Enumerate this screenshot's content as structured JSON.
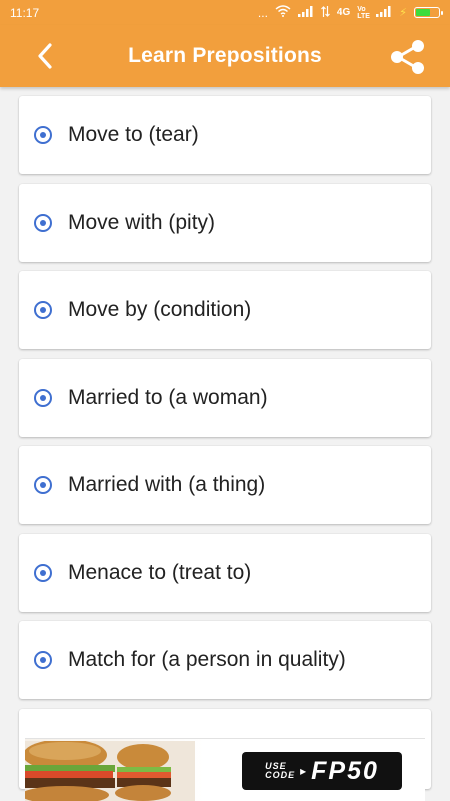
{
  "status_bar": {
    "time": "11:17",
    "dots": "...",
    "network": "4G",
    "volte": "Vo LTE"
  },
  "app_bar": {
    "title": "Learn Prepositions"
  },
  "items": [
    {
      "label": "Move to (tear)"
    },
    {
      "label": "Move with (pity)"
    },
    {
      "label": "Move by (condition)"
    },
    {
      "label": "Married to (a woman)"
    },
    {
      "label": "Married with (a thing)"
    },
    {
      "label": "Menace to (treat to)"
    },
    {
      "label": "Match for (a person in quality)"
    }
  ],
  "ad": {
    "use_code_line1": "USE",
    "use_code_line2": "CODE",
    "promo_code": "FP50"
  },
  "colors": {
    "app_bar": "#f29f3d",
    "radio_accent": "#3f6fd0",
    "background": "#f2f2f2",
    "card": "#ffffff"
  },
  "icons": {
    "back": "chevron-left-icon",
    "share": "share-icon",
    "wifi": "wifi-icon",
    "signal": "signal-icon",
    "battery": "battery-icon",
    "charging": "lightning-icon",
    "radio": "radio-selected-icon"
  }
}
